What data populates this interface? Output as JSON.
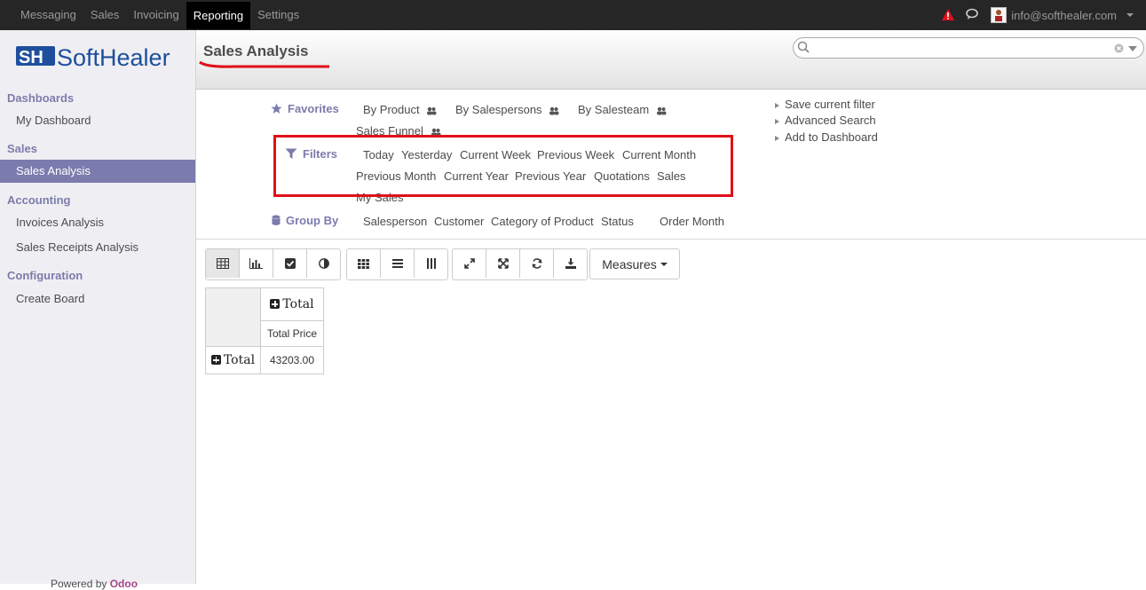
{
  "topbar": {
    "menu": [
      "Messaging",
      "Sales",
      "Invoicing",
      "Reporting",
      "Settings"
    ],
    "active": "Reporting",
    "user_email": "info@softhealer.com",
    "warning_color": "#e0101a"
  },
  "sidebar": {
    "logo_text": "SoftHealer",
    "sections": [
      {
        "title": "Dashboards",
        "items": [
          "My Dashboard"
        ]
      },
      {
        "title": "Sales",
        "items": [
          "Sales Analysis"
        ]
      },
      {
        "title": "Accounting",
        "items": [
          "Invoices Analysis",
          "Sales Receipts Analysis"
        ]
      },
      {
        "title": "Configuration",
        "items": [
          "Create Board"
        ]
      }
    ],
    "active_item": "Sales Analysis",
    "powered_by": "Powered by",
    "powered_brand": "Odoo"
  },
  "header": {
    "title": "Sales Analysis",
    "search_placeholder": ""
  },
  "search_panel": {
    "favorites_label": "Favorites",
    "favorites": [
      "By Product",
      "By Salespersons",
      "By Salesteam",
      "Sales Funnel"
    ],
    "filters_label": "Filters",
    "filters": [
      "Today",
      "Yesterday",
      "Current Week",
      "Previous Week",
      "Current Month",
      "Previous Month",
      "Current Year",
      "Previous Year",
      "Quotations",
      "Sales",
      "My Sales"
    ],
    "groupby_label": "Group By",
    "groupby": [
      "Salesperson",
      "Customer",
      "Category of Product",
      "Status",
      "Order Month"
    ],
    "actions": [
      "Save current filter",
      "Advanced Search",
      "Add to Dashboard"
    ]
  },
  "toolbar": {
    "measures_label": "Measures"
  },
  "pivot": {
    "col_header": "Total",
    "measure_header": "Total Price",
    "row_header": "Total",
    "value": "43203.00"
  },
  "accent_color": "#7c7bad"
}
